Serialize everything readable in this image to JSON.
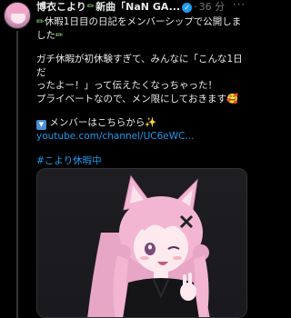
{
  "tweet": {
    "author": {
      "display_name": "博衣こより",
      "name_suffix": "新曲「NaN GA...",
      "verified_mark": "✓"
    },
    "separator": "·",
    "timestamp": "36 分",
    "more_label": "···",
    "lines": {
      "p1a": "休暇1日目の日記をメンバーシップで公開しま",
      "p1b": "した",
      "p2a": "ガチ休暇が初休験すぎて、みんなに「こんな1日だ",
      "p2b": "ったよー！」って伝えたくなっちゃった！",
      "p2c": "プライベートなので、メン限にしておきます",
      "p3": "メンバーはこちらから",
      "link": "youtube.com/channel/UC6eWC...",
      "hashtag": "#こより休暇中"
    },
    "emoji": {
      "pencil": "✏",
      "face": "🥰",
      "sparkle": "✨",
      "down_arrow": "▼"
    },
    "media": {
      "alt_icon": "vtuber-illustration",
      "colors": {
        "hair": "#f2b6d2",
        "hair_shadow": "#d98db4",
        "skin": "#fde9ee",
        "outfit": "#151518",
        "eye": "#7a4a7a"
      }
    }
  }
}
